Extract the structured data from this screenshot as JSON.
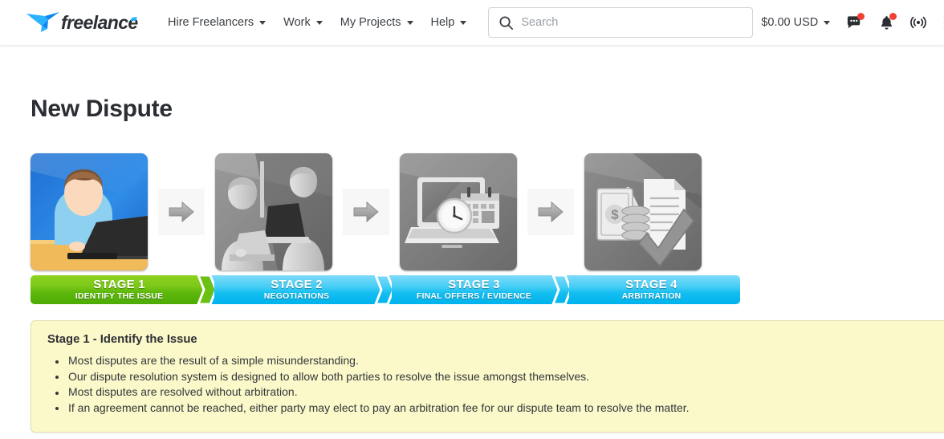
{
  "header": {
    "logo_text": "freelancer",
    "nav": [
      {
        "label": "Hire Freelancers",
        "has_caret": true
      },
      {
        "label": "Work",
        "has_caret": true
      },
      {
        "label": "My Projects",
        "has_caret": true
      },
      {
        "label": "Help",
        "has_caret": true
      }
    ],
    "search": {
      "placeholder": "Search",
      "value": ""
    },
    "currency": {
      "label": "$0.00 USD",
      "has_caret": true
    },
    "icons": [
      {
        "name": "messages-icon",
        "has_badge": true
      },
      {
        "name": "notifications-bell-icon",
        "has_badge": true
      },
      {
        "name": "broadcast-icon",
        "has_badge": false
      },
      {
        "name": "apps-grid-icon",
        "has_badge": false
      }
    ]
  },
  "main": {
    "page_title": "New Dispute",
    "stages": [
      {
        "number": "STAGE 1",
        "title": "IDENTIFY THE ISSUE",
        "state": "active",
        "color": "#5fb80c",
        "image": "person-at-laptop"
      },
      {
        "number": "STAGE 2",
        "title": "NEGOTIATIONS",
        "state": "upcoming",
        "color": "#13bdf0",
        "image": "two-people-negotiating"
      },
      {
        "number": "STAGE 3",
        "title": "FINAL OFFERS / EVIDENCE",
        "state": "upcoming",
        "color": "#13bdf0",
        "image": "laptop-clock-calendar"
      },
      {
        "number": "STAGE 4",
        "title": "ARBITRATION",
        "state": "upcoming",
        "color": "#13bdf0",
        "image": "money-documents-check"
      }
    ],
    "separator_icon": "right-arrow-icon",
    "info": {
      "heading": "Stage 1 - Identify the Issue",
      "bullets": [
        "Most disputes are the result of a simple misunderstanding.",
        "Our dispute resolution system is designed to allow both parties to resolve the issue amongst themselves.",
        "Most disputes are resolved without arbitration.",
        "If an agreement cannot be reached, either party may elect to pay an arbitration fee for our dispute team to resolve the matter."
      ],
      "background_color": "#fbf8c9",
      "border_color": "#e4dfb1"
    }
  }
}
